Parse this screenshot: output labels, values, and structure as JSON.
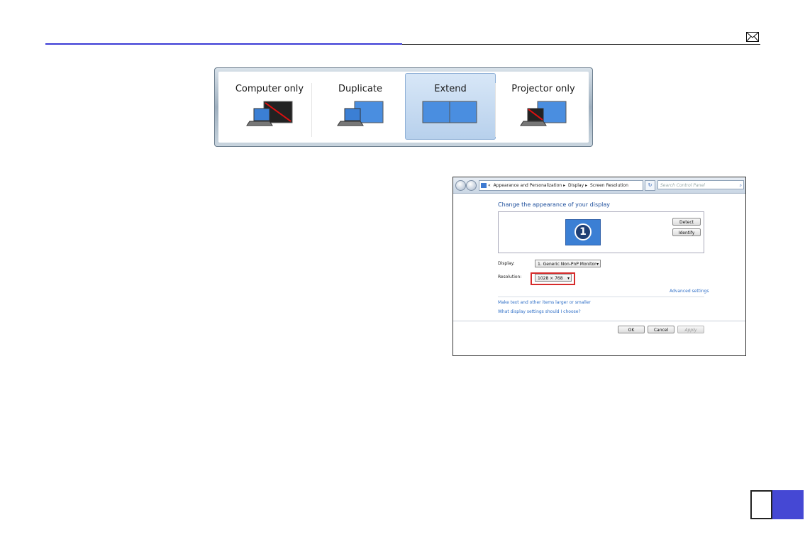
{
  "projection_switcher": {
    "options": [
      {
        "label": "Computer only"
      },
      {
        "label": "Duplicate"
      },
      {
        "label": "Extend",
        "selected": true
      },
      {
        "label": "Projector only"
      }
    ]
  },
  "screen_resolution_window": {
    "breadcrumb": {
      "items": [
        "Appearance and Personalization",
        "Display",
        "Screen Resolution"
      ]
    },
    "search_placeholder": "Search Control Panel",
    "title": "Change the appearance of your display",
    "monitor_number": "1",
    "buttons": {
      "detect": "Detect",
      "identify": "Identify",
      "ok": "OK",
      "cancel": "Cancel",
      "apply": "Apply"
    },
    "display_label": "Display:",
    "display_value": "1. Generic Non-PnP Monitor",
    "resolution_label": "Resolution:",
    "resolution_value": "1028 × 768",
    "links": {
      "advanced": "Advanced settings",
      "text_size": "Make text and other items larger or smaller",
      "which_settings": "What display settings should I choose?"
    }
  },
  "icons": {
    "header": "mail-icon",
    "search": "magnifier-icon"
  },
  "colors": {
    "header_rule": "#3b3bd6",
    "page_tab": "#4548d4",
    "highlight_box": "#d62b2b",
    "link": "#2f6fc7"
  }
}
